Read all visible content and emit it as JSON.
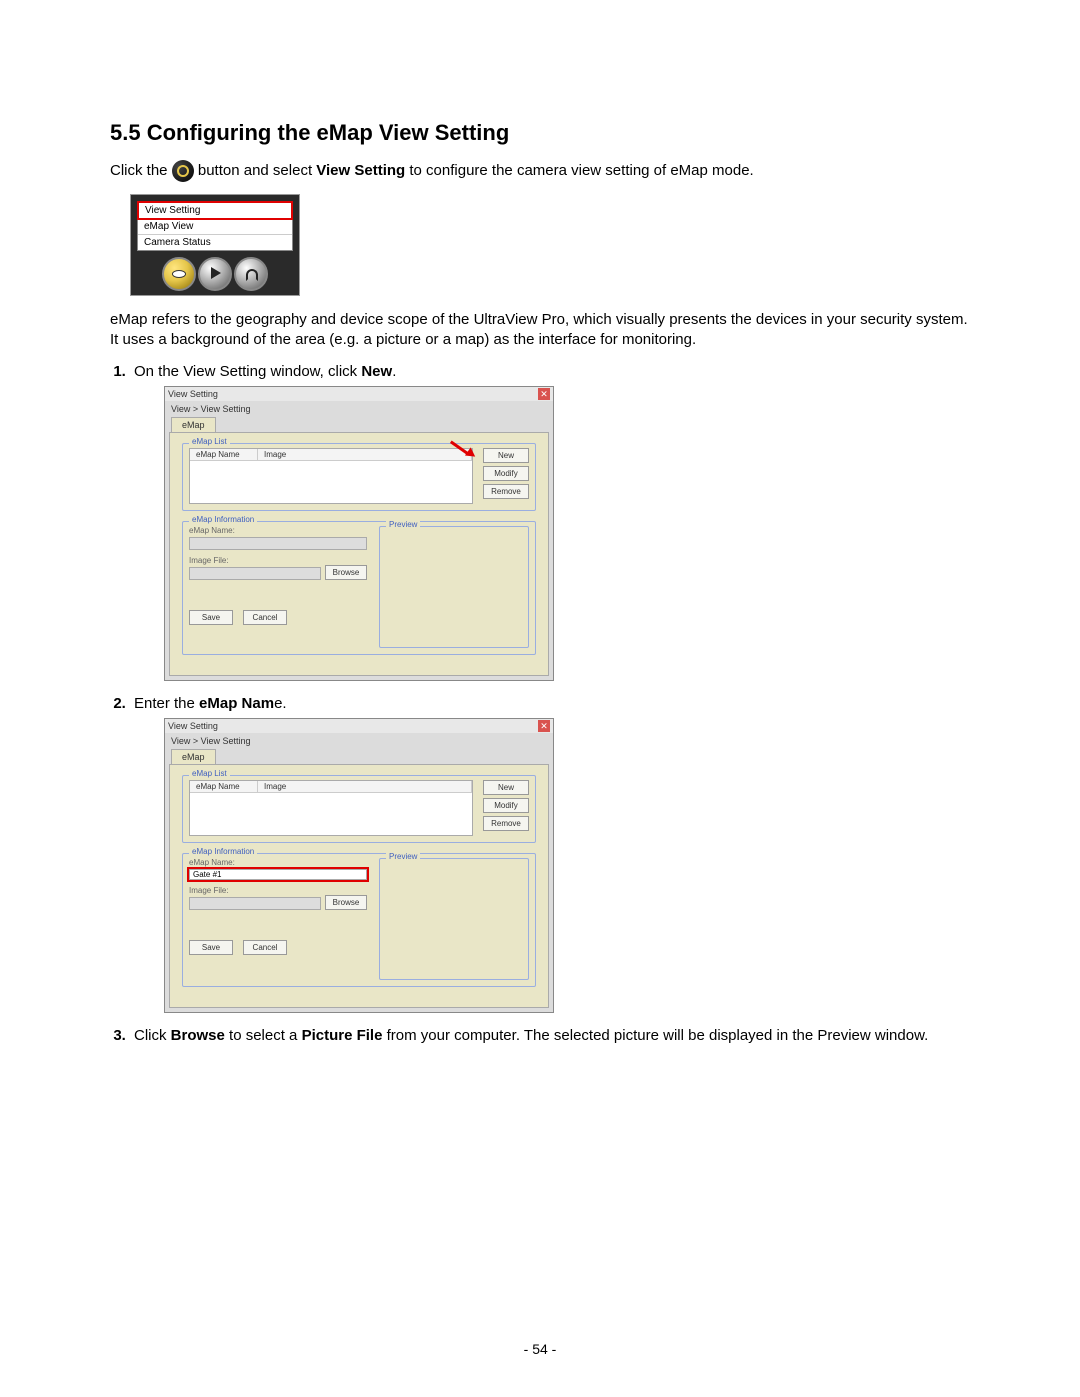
{
  "heading": "5.5  Configuring the eMap View Setting",
  "intro": {
    "pre": "Click the ",
    "mid": " button and select ",
    "bold": "View Setting",
    "post": " to configure the camera view setting of eMap mode."
  },
  "context_menu": {
    "items": [
      "View Setting",
      "eMap View",
      "Camera Status"
    ],
    "toolbar_icons": [
      "eye-icon",
      "play-icon",
      "lock-icon"
    ]
  },
  "paragraph2": "eMap refers to the geography and device scope of the UltraView Pro, which visually presents the devices in your security system. It uses a background of the area (e.g. a picture or a map) as the interface for monitoring.",
  "step1": {
    "pre": "On the View Setting window, click ",
    "bold": "New",
    "post": "."
  },
  "step2": {
    "pre": "Enter the ",
    "bold": "eMap Nam",
    "post": "e."
  },
  "step3": {
    "pre": "Click ",
    "b1": "Browse",
    "mid1": " to select a ",
    "b2": "Picture File",
    "post": " from your computer. The selected picture will be displayed in the Preview window."
  },
  "dialog": {
    "title": "View Setting",
    "breadcrumb": "View > View Setting",
    "tab": "eMap",
    "group_list": "eMap List",
    "col1": "eMap Name",
    "col2": "Image",
    "btn_new": "New",
    "btn_modify": "Modify",
    "btn_remove": "Remove",
    "group_info": "eMap Information",
    "lbl_name": "eMap Name:",
    "lbl_file": "Image File:",
    "btn_browse": "Browse",
    "lbl_preview": "Preview",
    "btn_save": "Save",
    "btn_cancel": "Cancel",
    "sample_name": "Gate #1"
  },
  "page_number": "- 54 -"
}
